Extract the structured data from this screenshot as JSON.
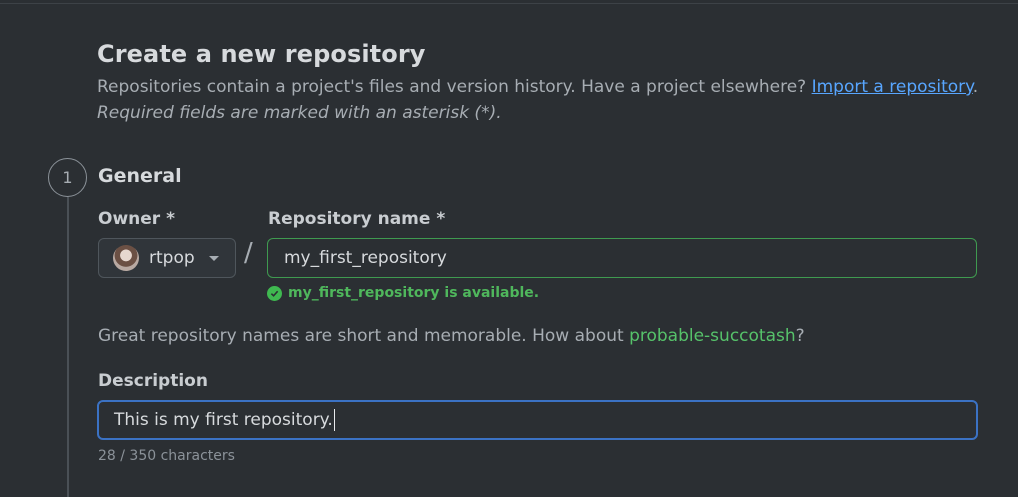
{
  "page": {
    "title": "Create a new repository",
    "intro_text": "Repositories contain a project's files and version history. Have a project elsewhere? ",
    "import_link": "Import a repository",
    "intro_suffix": ".",
    "required_note": "Required fields are marked with an asterisk (*)."
  },
  "section": {
    "step_number": "1",
    "title": "General"
  },
  "owner": {
    "label": "Owner *",
    "value": "rtpop"
  },
  "separator": "/",
  "repository": {
    "label": "Repository name *",
    "value": "my_first_repository",
    "availability": "my_first_repository is available."
  },
  "suggestion": {
    "prefix": "Great repository names are short and memorable. How about ",
    "name": "probable-succotash",
    "suffix": "?"
  },
  "description": {
    "label": "Description",
    "value": "This is my first repository.",
    "char_count": "28 / 350 characters"
  },
  "colors": {
    "link": "#58a6ff",
    "success": "#3fb950",
    "focus": "#3b72c4"
  }
}
